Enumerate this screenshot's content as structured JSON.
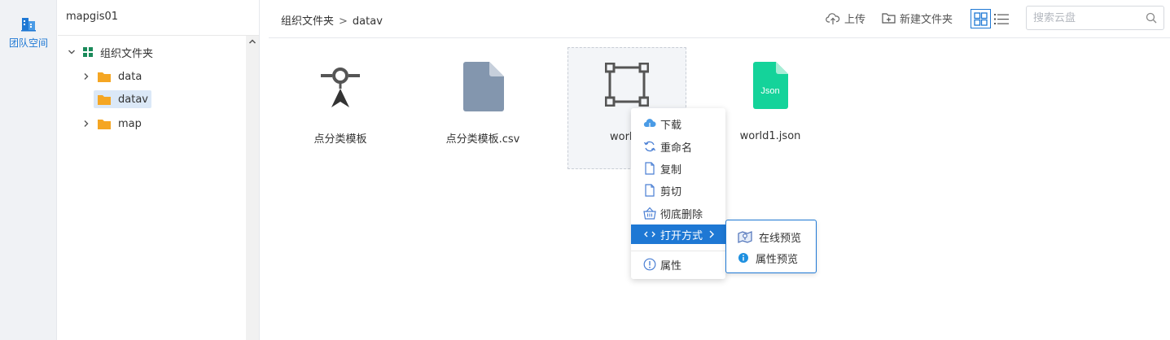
{
  "rail": {
    "team_label": "团队空间",
    "team_icon": "building-icon",
    "color": "#1e78d4"
  },
  "tree": {
    "header": "mapgis01",
    "root": {
      "label": "组织文件夹",
      "expanded": true
    },
    "children": [
      {
        "label": "data",
        "collapsed": true
      },
      {
        "label": "datav",
        "selected": true
      },
      {
        "label": "map",
        "collapsed": true
      }
    ],
    "folder_color": "#f5a623"
  },
  "topbar": {
    "breadcrumb": [
      "组织文件夹",
      "datav"
    ],
    "breadcrumb_sep": ">",
    "upload": "上传",
    "new_folder": "新建文件夹",
    "search_placeholder": "搜索云盘",
    "view_mode": "grid"
  },
  "files": [
    {
      "name": "点分类模板",
      "icon": "point-symbol-icon"
    },
    {
      "name": "点分类模板.csv",
      "icon": "document-icon"
    },
    {
      "name": "world",
      "icon": "polygon-frame-icon",
      "hovered": true
    },
    {
      "name": "world1.json",
      "icon": "json-file-icon",
      "badge": "Json"
    }
  ],
  "context_menu": {
    "items": [
      {
        "label": "下载",
        "icon": "cloud-download-icon"
      },
      {
        "label": "重命名",
        "icon": "rename-refresh-icon"
      },
      {
        "label": "复制",
        "icon": "copy-file-icon"
      },
      {
        "label": "剪切",
        "icon": "cut-file-icon"
      },
      {
        "label": "彻底删除",
        "icon": "basket-delete-icon"
      },
      {
        "label": "打开方式",
        "icon": "open-with-icon",
        "active": true,
        "has_submenu": true
      },
      {
        "label": "属性",
        "icon": "info-circle-icon"
      }
    ],
    "submenu": [
      {
        "label": "在线预览",
        "icon": "map-preview-icon"
      },
      {
        "label": "属性预览",
        "icon": "info-dot-icon"
      }
    ]
  },
  "accent_color": "#1e78d4"
}
